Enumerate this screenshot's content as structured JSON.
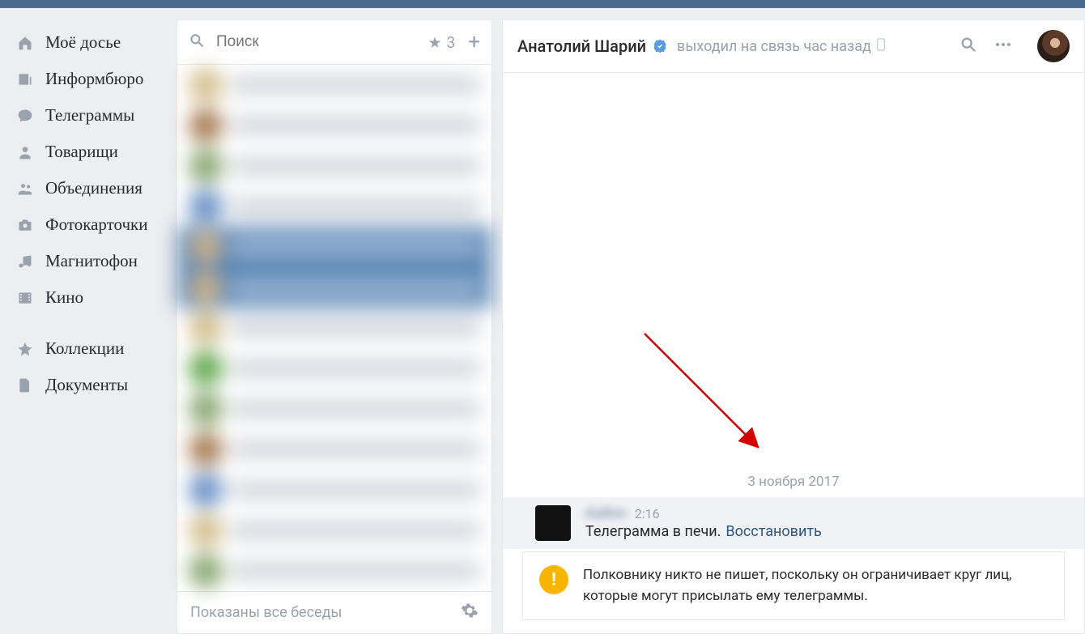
{
  "sidebar": {
    "items": [
      {
        "icon": "home",
        "label": "Моё досье"
      },
      {
        "icon": "news",
        "label": "Информбюро"
      },
      {
        "icon": "message",
        "label": "Телеграммы"
      },
      {
        "icon": "user",
        "label": "Товарищи"
      },
      {
        "icon": "group",
        "label": "Объединения"
      },
      {
        "icon": "camera",
        "label": "Фотокарточки"
      },
      {
        "icon": "music",
        "label": "Магнитофон"
      },
      {
        "icon": "film",
        "label": "Кино"
      },
      {
        "icon": "star",
        "label": "Коллекции"
      },
      {
        "icon": "doc",
        "label": "Документы"
      }
    ]
  },
  "dialogs": {
    "search_placeholder": "Поиск",
    "starred_count": "3",
    "footer_text": "Показаны все беседы"
  },
  "chat": {
    "title": "Анатолий Шарий",
    "status": "выходил на связь час назад",
    "date_label": "3 ноября 2017",
    "message": {
      "time": "2:16",
      "text": "Телеграмма в печи.",
      "restore_label": "Восстановить"
    },
    "restriction": "Полковнику никто не пишет, поскольку он ограничивает круг лиц, которые могут присылать ему телеграммы."
  }
}
